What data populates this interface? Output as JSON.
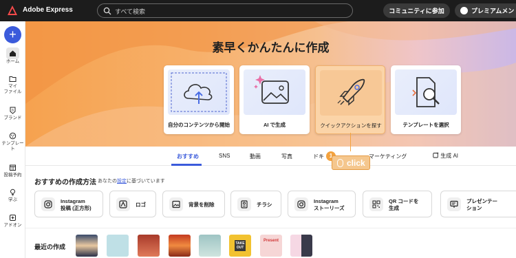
{
  "topbar": {
    "app_name": "Adobe Express",
    "search_placeholder": "すべて検索",
    "community_label": "コミュニティに参加",
    "premium_label": "プレミアムメン"
  },
  "sidebar": {
    "items": [
      {
        "label": "ホーム",
        "icon": "home-icon"
      },
      {
        "label": "マイ\nファイル",
        "icon": "folder-icon"
      },
      {
        "label": "ブランド",
        "icon": "brand-icon"
      },
      {
        "label": "テンプレー\nト",
        "icon": "template-icon"
      },
      {
        "label": "投稿予約",
        "icon": "calendar-icon"
      },
      {
        "label": "学ぶ",
        "icon": "lightbulb-icon"
      },
      {
        "label": "アドオン",
        "icon": "addon-icon"
      }
    ]
  },
  "hero": {
    "title": "素早くかんたんに作成",
    "cards": [
      {
        "label": "自分のコンテンツから開始",
        "icon": "cloud-upload-icon"
      },
      {
        "label": "AI で生成",
        "icon": "ai-image-icon"
      },
      {
        "label": "クイックアクションを探す",
        "icon": "rocket-icon"
      },
      {
        "label": "テンプレートを選択",
        "icon": "template-search-icon"
      }
    ]
  },
  "tabs": [
    "おすすめ",
    "SNS",
    "動画",
    "写真",
    "ドキ",
    "マーケティング",
    "生成 AI"
  ],
  "recommend": {
    "title": "おすすめの作成方法",
    "subtitle_pre": "あなたの",
    "subtitle_link": "設定",
    "subtitle_post": "に基づいています",
    "actions": [
      {
        "line1": "Instagram",
        "line2": "投稿 (正方形)",
        "icon": "instagram-icon"
      },
      {
        "line1": "ロゴ",
        "line2": "",
        "icon": "logo-icon"
      },
      {
        "line1": "背景を削除",
        "line2": "",
        "icon": "remove-background-icon"
      },
      {
        "line1": "チラシ",
        "line2": "",
        "icon": "flyer-icon"
      },
      {
        "line1": "Instagram",
        "line2": "ストーリーズ",
        "icon": "instagram-icon"
      },
      {
        "line1": "QR コードを",
        "line2": "生成",
        "icon": "qr-code-icon"
      },
      {
        "line1": "プレゼンテー",
        "line2": "ション",
        "icon": "presentation-icon"
      }
    ]
  },
  "recent": {
    "title": "最近の作成",
    "thumb_texts": [
      "TAKE OUT",
      "Present"
    ]
  },
  "callout": {
    "badge": "1",
    "text": "click"
  },
  "colors": {
    "accent": "#3b5bdb",
    "callout": "#f3a23e",
    "topbar": "#1c1c1c"
  }
}
